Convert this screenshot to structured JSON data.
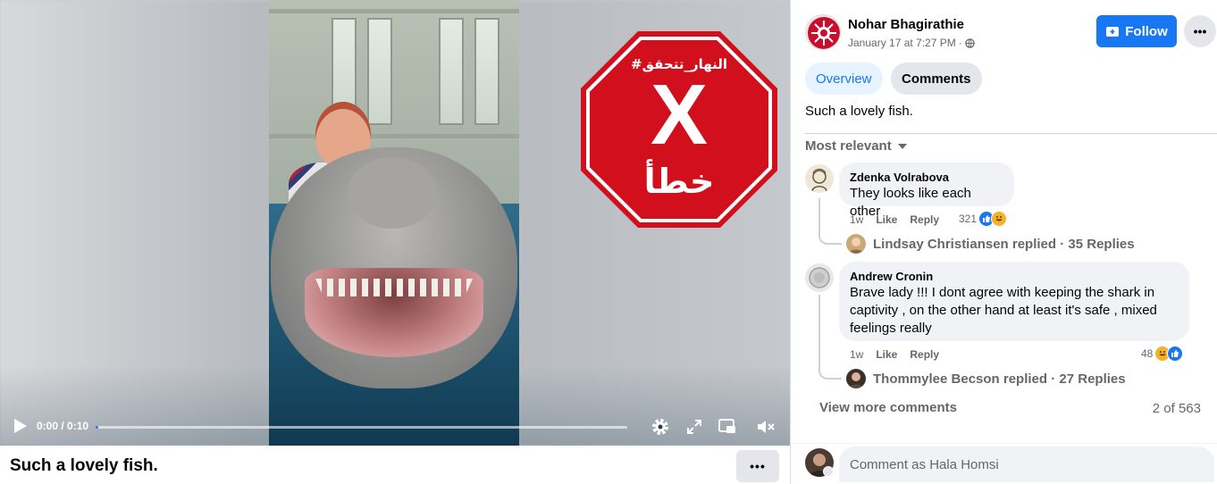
{
  "video": {
    "time": "0:00 / 0:10",
    "progress": 0.005,
    "stamp": {
      "top_text": "#النهار_تتحقق",
      "mark": "X",
      "bottom_text": "خطأ"
    }
  },
  "caption": "Such a lovely fish.",
  "post": {
    "author": "Nohar Bhagirathie",
    "date": "January 17 at 7:27 PM",
    "date_separator": "·",
    "follow_label": "Follow",
    "text": "Such a lovely fish."
  },
  "tabs": [
    {
      "label": "Overview",
      "active": true
    },
    {
      "label": "Comments",
      "active": false
    }
  ],
  "sort_label": "Most relevant",
  "comments": [
    {
      "author": "Zdenka Volrabova",
      "text": "They looks like each other",
      "time": "1w",
      "like": "Like",
      "reply": "Reply",
      "reactions": "321",
      "reply_summary": "Lindsay Christiansen replied · 35 Replies"
    },
    {
      "author": "Andrew Cronin",
      "text": "Brave lady !!! I dont agree with keeping the shark in captivity , on the other hand at least it's safe , mixed feelings really",
      "time": "1w",
      "like": "Like",
      "reply": "Reply",
      "reactions": "48",
      "reply_summary": "Thommylee Becson replied · 27 Replies"
    }
  ],
  "view_more_label": "View more comments",
  "comment_count": "2 of 563",
  "composer": {
    "placeholder": "Comment as Hala Homsi"
  },
  "colors": {
    "accent": "#1877f2",
    "stamp_red": "#d10f1d",
    "secondary_text": "#65676b"
  }
}
